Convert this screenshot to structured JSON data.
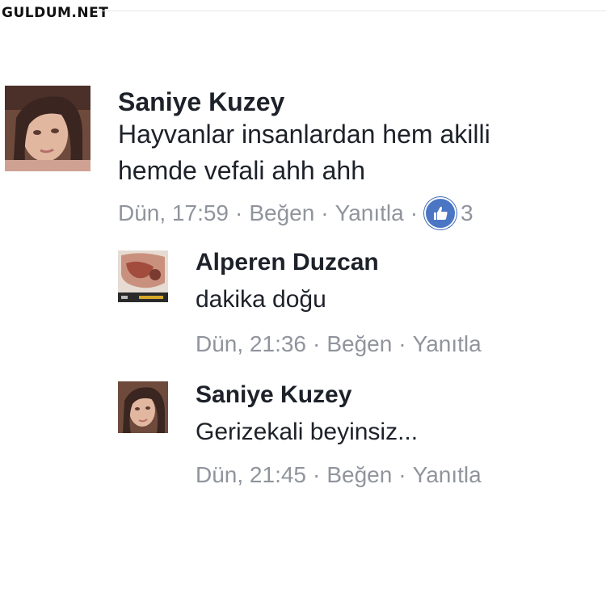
{
  "watermark": "GULDUM.NET",
  "comments": [
    {
      "author": "Saniye Kuzey",
      "lines": [
        "Hayvanlar insanlardan hem akilli",
        "hemde vefali ahh ahh"
      ],
      "time": "Dün, 17:59",
      "like_label": "Beğen",
      "reply_label": "Yanıtla",
      "reaction_count": "3",
      "avatar": "woman-profile-photo"
    },
    {
      "author": "Alperen Duzcan",
      "lines": [
        "dakika doğu"
      ],
      "time": "Dün, 21:36",
      "like_label": "Beğen",
      "reply_label": "Yanıtla",
      "avatar": "profile-photo"
    },
    {
      "author": "Saniye Kuzey",
      "lines": [
        "Gerizekali beyinsiz..."
      ],
      "time": "Dün, 21:45",
      "like_label": "Beğen",
      "reply_label": "Yanıtla",
      "avatar": "woman-profile-photo"
    }
  ],
  "separator": "·",
  "colors": {
    "text": "#1d2129",
    "meta": "#90949c",
    "like_badge": "#4a76c4"
  },
  "icons": {
    "reaction": "thumbs-up-icon"
  }
}
